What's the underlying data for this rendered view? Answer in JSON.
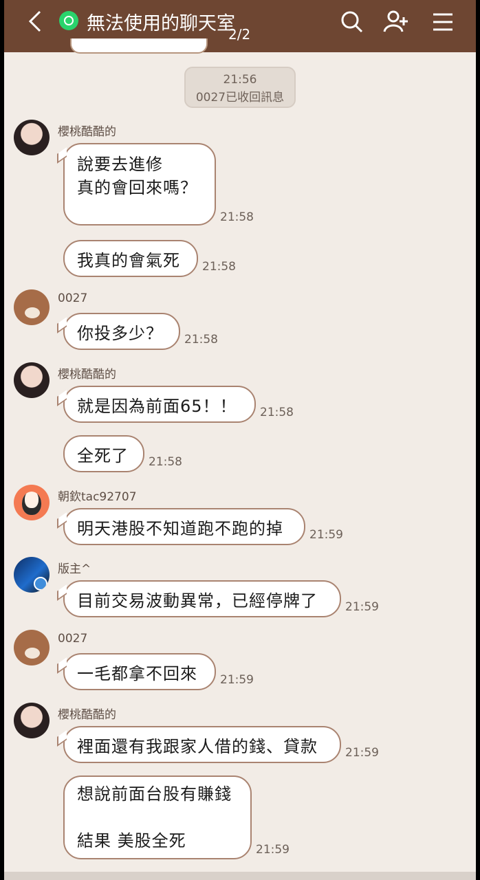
{
  "header": {
    "title": "無法使用的聊天室",
    "page_indicator": "2/2",
    "icons": [
      "back-icon",
      "open-chat-badge-icon",
      "search-icon",
      "add-friend-icon",
      "menu-icon"
    ]
  },
  "system": {
    "time": "21:56",
    "text": "0027已收回訊息"
  },
  "messages": [
    {
      "sender": "櫻桃酷酷的",
      "text": "說要去進修\n真的會回來嗎？",
      "time": "21:58"
    },
    {
      "text": "我真的會氣死",
      "time": "21:58"
    },
    {
      "sender": "0027",
      "text": "你投多少？",
      "time": "21:58"
    },
    {
      "sender": "櫻桃酷酷的",
      "text": "就是因為前面65！！",
      "time": "21:58"
    },
    {
      "text": "全死了",
      "time": "21:58"
    },
    {
      "sender": "朝欽tac92707",
      "text": "明天港股不知道跑不跑的掉",
      "time": "21:59"
    },
    {
      "sender": "版主^",
      "text": "目前交易波動異常，已經停牌了",
      "time": "21:59"
    },
    {
      "sender": "0027",
      "text": "一毛都拿不回來",
      "time": "21:59"
    },
    {
      "sender": "櫻桃酷酷的",
      "text": "裡面還有我跟家人借的錢、貸款",
      "time": "21:59"
    },
    {
      "text": "想說前面台股有賺錢\n\n結果 美股全死",
      "time": "21:59"
    }
  ]
}
